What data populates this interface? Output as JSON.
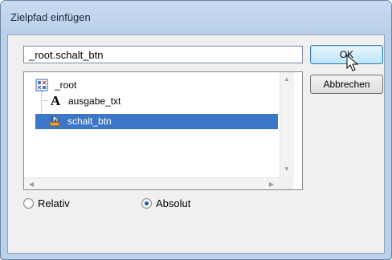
{
  "dialog": {
    "title": "Zielpfad einfügen"
  },
  "path_input": {
    "value": "_root.schalt_btn"
  },
  "buttons": {
    "ok_label": "OK",
    "cancel_label": "Abbrechen"
  },
  "tree": {
    "items": [
      {
        "label": "_root",
        "icon": "movieclip-icon",
        "level": 0,
        "selected": false
      },
      {
        "label": "ausgabe_txt",
        "icon": "text-field-icon",
        "level": 1,
        "selected": false
      },
      {
        "label": "schalt_btn",
        "icon": "button-symbol-icon",
        "level": 1,
        "selected": true
      }
    ]
  },
  "path_mode": {
    "options": [
      {
        "label": "Relativ",
        "checked": false
      },
      {
        "label": "Absolut",
        "checked": true
      }
    ]
  },
  "colors": {
    "selection": "#3c76c6",
    "title_bar": "#bcd1ea",
    "dialog_body": "#f0f0f0"
  }
}
